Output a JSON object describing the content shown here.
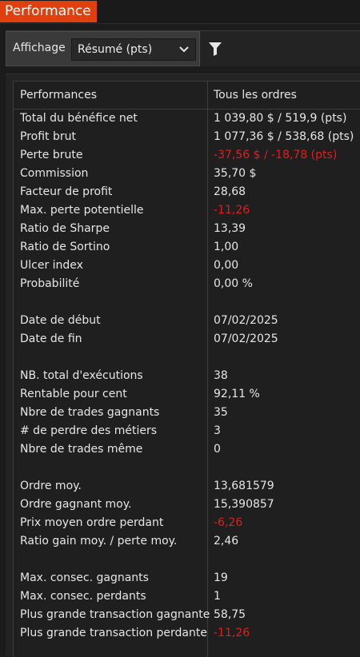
{
  "tab": {
    "title": "Performance"
  },
  "toolbar": {
    "display_label": "Affichage",
    "display_value": "Résumé (pts)"
  },
  "table": {
    "col_label": "Performances",
    "col_value": "Tous les ordres",
    "rows": [
      {
        "label": "Total du bénéfice net",
        "value": "1 039,80 $ / 519,9 (pts)",
        "negative": false
      },
      {
        "label": "Profit brut",
        "value": "1 077,36 $ / 538,68 (pts)",
        "negative": false
      },
      {
        "label": "Perte brute",
        "value": "-37,56 $ / -18,78 (pts)",
        "negative": true
      },
      {
        "label": "Commission",
        "value": "35,70 $",
        "negative": false
      },
      {
        "label": "Facteur de profit",
        "value": "28,68",
        "negative": false
      },
      {
        "label": "Max. perte potentielle",
        "value": "-11,26",
        "negative": true
      },
      {
        "label": "Ratio de Sharpe",
        "value": "13,39",
        "negative": false
      },
      {
        "label": "Ratio de Sortino",
        "value": "1,00",
        "negative": false
      },
      {
        "label": "Ulcer index",
        "value": "0,00",
        "negative": false
      },
      {
        "label": "Probabilité",
        "value": "0,00 %",
        "negative": false
      },
      null,
      {
        "label": "Date de début",
        "value": "07/02/2025",
        "negative": false
      },
      {
        "label": "Date de fin",
        "value": "07/02/2025",
        "negative": false
      },
      null,
      {
        "label": "NB. total d'exécutions",
        "value": "38",
        "negative": false
      },
      {
        "label": "Rentable pour cent",
        "value": "92,11 %",
        "negative": false
      },
      {
        "label": "Nbre de trades gagnants",
        "value": "35",
        "negative": false
      },
      {
        "label": "# de perdre des métiers",
        "value": "3",
        "negative": false
      },
      {
        "label": "Nbre de trades même",
        "value": "0",
        "negative": false
      },
      null,
      {
        "label": "Ordre moy.",
        "value": "13,681579",
        "negative": false
      },
      {
        "label": "Ordre gagnant moy.",
        "value": "15,390857",
        "negative": false
      },
      {
        "label": "Prix moyen ordre perdant",
        "value": "-6,26",
        "negative": true
      },
      {
        "label": "Ratio gain moy. / perte moy.",
        "value": "2,46",
        "negative": false
      },
      null,
      {
        "label": "Max. consec. gagnants",
        "value": "19",
        "negative": false
      },
      {
        "label": "Max. consec. perdants",
        "value": "1",
        "negative": false
      },
      {
        "label": "Plus grande transaction gagnante",
        "value": "58,75",
        "negative": false
      },
      {
        "label": "Plus grande transaction perdante",
        "value": "-11,26",
        "negative": true
      }
    ]
  },
  "colors": {
    "accent": "#e0400e",
    "negative": "#e21f1f"
  },
  "icons": {
    "filter": "filter-icon",
    "dropdown": "chevron-down-icon"
  }
}
